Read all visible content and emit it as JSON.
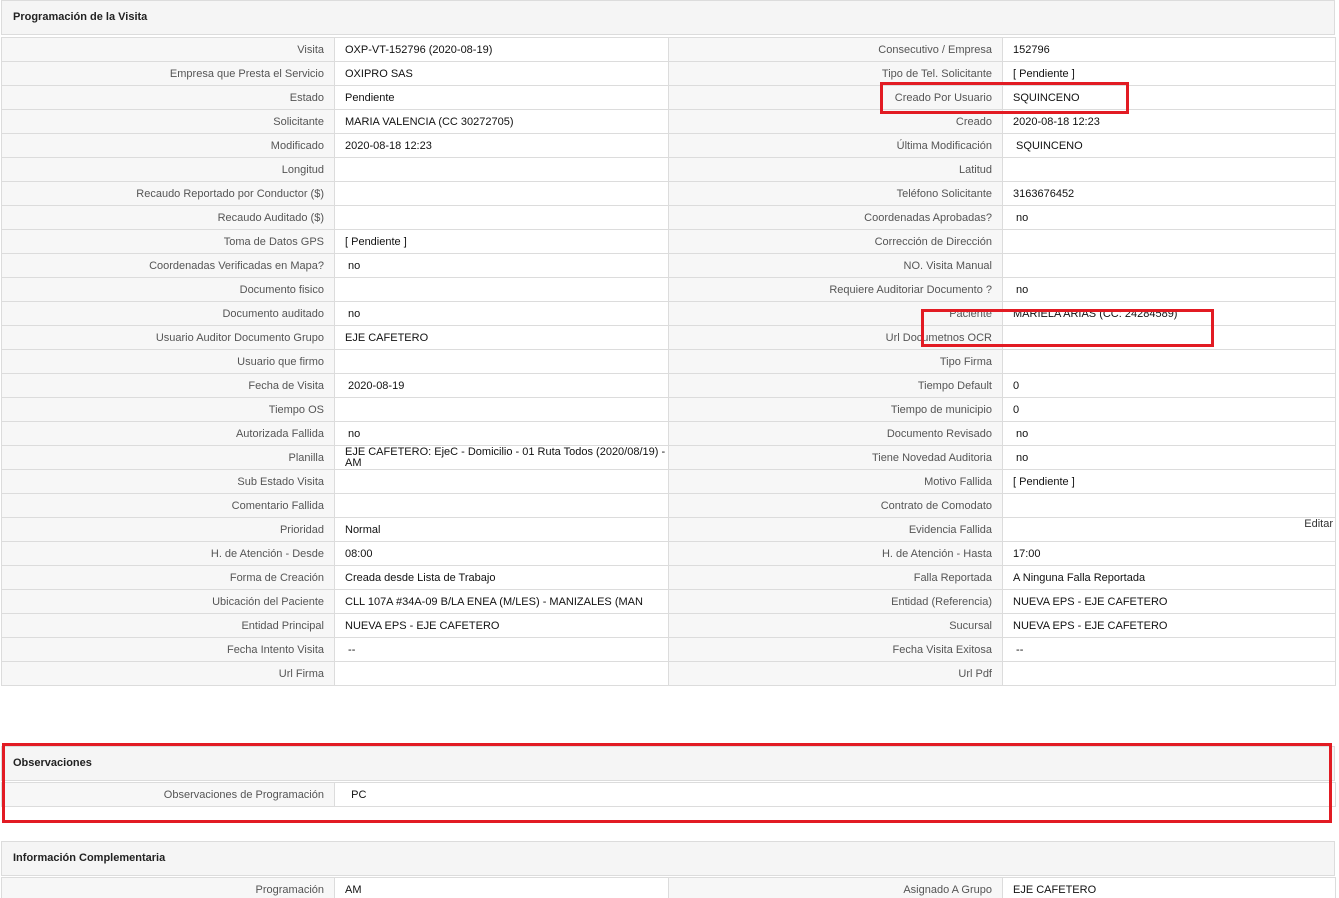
{
  "sections": {
    "programacion": {
      "title": "Programación de la Visita"
    },
    "observaciones": {
      "title": "Observaciones"
    },
    "complementaria": {
      "title": "Información Complementaria"
    }
  },
  "rows": [
    {
      "l1": "Visita",
      "v1": "OXP-VT-152796 (2020-08-19)",
      "l2": "Consecutivo / Empresa",
      "v2": "152796"
    },
    {
      "l1": "Empresa que Presta el Servicio",
      "v1": "OXIPRO SAS",
      "l2": "Tipo de Tel. Solicitante",
      "v2": "[ Pendiente ]"
    },
    {
      "l1": "Estado",
      "v1": "Pendiente",
      "l2": "Creado Por Usuario",
      "v2": "SQUINCENO"
    },
    {
      "l1": "Solicitante",
      "v1": "MARIA VALENCIA (CC 30272705)",
      "l2": "Creado",
      "v2": "2020-08-18 12:23"
    },
    {
      "l1": "Modificado",
      "v1": "2020-08-18 12:23",
      "l2": "Última Modificación",
      "v2": " SQUINCENO"
    },
    {
      "l1": "Longitud",
      "v1": "",
      "l2": "Latitud",
      "v2": ""
    },
    {
      "l1": "Recaudo Reportado por Conductor ($)",
      "v1": "",
      "l2": "Teléfono Solicitante",
      "v2": "3163676452"
    },
    {
      "l1": "Recaudo Auditado ($)",
      "v1": "",
      "l2": "Coordenadas Aprobadas?",
      "v2": " no"
    },
    {
      "l1": "Toma de Datos GPS",
      "v1": "[ Pendiente ]",
      "l2": "Corrección de Dirección",
      "v2": ""
    },
    {
      "l1": "Coordenadas Verificadas en Mapa?",
      "v1": " no",
      "l2": "NO. Visita Manual",
      "v2": ""
    },
    {
      "l1": "Documento fisico",
      "v1": "",
      "l2": "Requiere Auditoriar Documento ?",
      "v2": " no"
    },
    {
      "l1": "Documento auditado",
      "v1": " no",
      "l2": "Paciente",
      "v2": "MARIELA ARIAS (CC: 24284589)"
    },
    {
      "l1": "Usuario Auditor Documento Grupo",
      "v1": "EJE CAFETERO",
      "l2": "Url Documetnos OCR",
      "v2": ""
    },
    {
      "l1": "Usuario que firmo",
      "v1": "",
      "l2": "Tipo Firma",
      "v2": ""
    },
    {
      "l1": "Fecha de Visita",
      "v1": " 2020-08-19",
      "l2": "Tiempo Default",
      "v2": "0"
    },
    {
      "l1": "Tiempo OS",
      "v1": "",
      "l2": "Tiempo de municipio",
      "v2": "0"
    },
    {
      "l1": "Autorizada Fallida",
      "v1": " no",
      "l2": "Documento Revisado",
      "v2": " no"
    },
    {
      "l1": "Planilla",
      "v1": "EJE CAFETERO: EjeC - Domicilio - 01 Ruta Todos (2020/08/19) - AM",
      "l2": "Tiene Novedad Auditoria",
      "v2": " no"
    },
    {
      "l1": "Sub Estado Visita",
      "v1": "",
      "l2": "Motivo Fallida",
      "v2": "[ Pendiente ]"
    },
    {
      "l1": "Comentario Fallida",
      "v1": "",
      "l2": "Contrato de Comodato",
      "v2": ""
    },
    {
      "l1": "Prioridad",
      "v1": "Normal",
      "l2": "Evidencia Fallida",
      "v2": ""
    },
    {
      "l1": "H. de Atención - Desde",
      "v1": "08:00",
      "l2": "H. de Atención - Hasta",
      "v2": "17:00"
    },
    {
      "l1": "Forma de Creación",
      "v1": "Creada desde Lista de Trabajo",
      "l2": "Falla Reportada",
      "v2": "A Ninguna Falla Reportada"
    },
    {
      "l1": "Ubicación del Paciente",
      "v1": "CLL 107A #34A-09 B/LA ENEA (M/LES) - MANIZALES (MAN",
      "l2": "Entidad (Referencia)",
      "v2": "NUEVA EPS - EJE CAFETERO"
    },
    {
      "l1": "Entidad Principal",
      "v1": "NUEVA EPS - EJE CAFETERO",
      "l2": "Sucursal",
      "v2": "NUEVA EPS - EJE CAFETERO"
    },
    {
      "l1": "Fecha Intento Visita",
      "v1": " --",
      "l2": "Fecha Visita Exitosa",
      "v2": " --"
    },
    {
      "l1": "Url Firma",
      "v1": "",
      "l2": "Url Pdf",
      "v2": ""
    }
  ],
  "editar_label": "Editar",
  "observaciones": {
    "label": "Observaciones de Programación",
    "value": "  PC"
  },
  "complementaria": {
    "l1": "Programación",
    "v1": "AM",
    "l2": "Asignado A Grupo",
    "v2": "EJE CAFETERO"
  },
  "highlight_color": "#e21b23"
}
